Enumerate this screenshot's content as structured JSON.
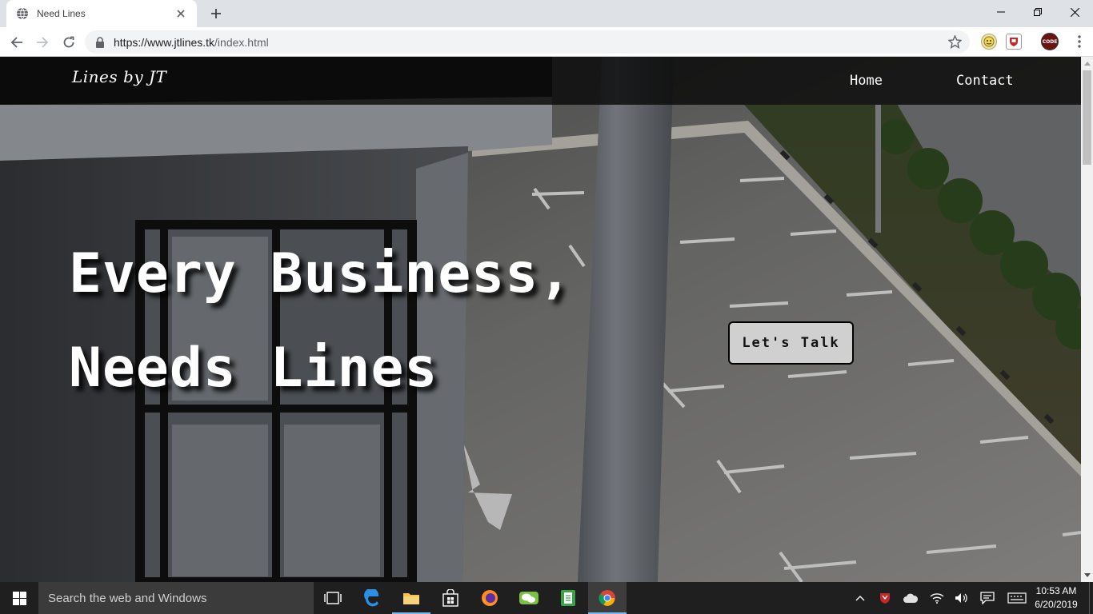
{
  "browser": {
    "tab_title": "Need Lines",
    "url_host": "https://www.jtlines.tk",
    "url_path": "/index.html"
  },
  "site": {
    "brand": "Lines by JT",
    "nav": [
      {
        "label": "Home"
      },
      {
        "label": "Contact"
      }
    ],
    "headline_line1": "Every Business,",
    "headline_line2": "Needs Lines",
    "cta_label": "Let's Talk"
  },
  "taskbar": {
    "search_placeholder": "Search the web and Windows",
    "time": "10:53 AM",
    "date": "6/20/2019"
  },
  "colors": {
    "accent": "#76b9ed",
    "nav_bg": "#080808",
    "tab_bar": "#dee1e6"
  }
}
